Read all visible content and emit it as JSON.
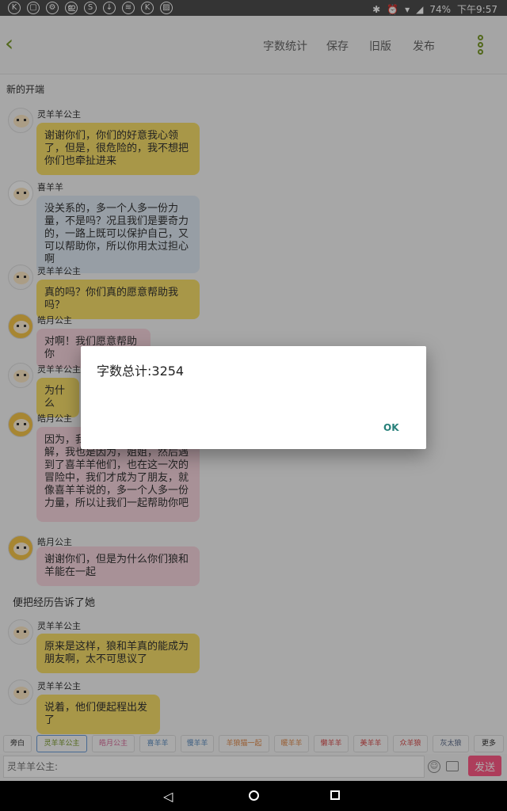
{
  "status_bar": {
    "battery": "74%",
    "time": "下午9:57",
    "left_icons": [
      "K",
      "▢",
      "⚙",
      "ഇ",
      "S",
      "↓",
      "≋",
      "K",
      "▨"
    ]
  },
  "header": {
    "back_icon": "chevron-left",
    "buttons": [
      "字数统计",
      "保存",
      "旧版",
      "发布"
    ],
    "more_icon": "vertical-dots"
  },
  "document": {
    "title": "新的开端"
  },
  "messages": [
    {
      "speaker": "灵羊羊公主",
      "text": "谢谢你们，你们的好意我心领了，但是，很危险的，我不想把你们也牵扯进来",
      "color": "#f8df6a",
      "avatar": "ling"
    },
    {
      "speaker": "喜羊羊",
      "text": "没关系的，多一个人多一份力量，不是吗？况且我们是要奇力的，一路上既可以保护自己，又可以帮助你，所以你用太过担心啊",
      "color": "#dfe9f3",
      "avatar": "xi"
    },
    {
      "speaker": "灵羊羊公主",
      "text": "真的吗？你们真的愿意帮助我吗？",
      "color": "#f8df6a",
      "avatar": "ling"
    },
    {
      "speaker": "皓月公主",
      "text": "对啊！我们愿意帮助你",
      "color": "#f8d6df",
      "avatar": "hao"
    },
    {
      "speaker": "灵羊羊公主",
      "text": "为什么",
      "color": "#f8df6a",
      "avatar": "ling"
    },
    {
      "speaker": "皓月公主",
      "text": "因为，我……在的感受我能理解，我也是因为，姐姐，然后遇到了喜羊羊他们，也在这一次的冒险中，我们才成为了朋友，就像喜羊羊说的，多一个人多一份力量，所以让我们一起帮助你吧",
      "color": "#f8d6df",
      "avatar": "hao"
    },
    {
      "speaker": "皓月公主",
      "text": "谢谢你们，但是为什么你们狼和羊能在一起",
      "color": "#f8d6df",
      "avatar": "hao"
    },
    {
      "narration": "便把经历告诉了她"
    },
    {
      "speaker": "灵羊羊公主",
      "text": "原来是这样，狼和羊真的能成为朋友啊，太不可思议了",
      "color": "#f8df6a",
      "avatar": "ling"
    },
    {
      "speaker": "灵羊羊公主",
      "text": "说着，他们便起程出发了",
      "color": "#f8df6a",
      "avatar": "ling"
    }
  ],
  "character_tabs": [
    {
      "label": "旁白",
      "color": "#333333"
    },
    {
      "label": "灵羊羊公主",
      "color": "#7a9a2a"
    },
    {
      "label": "皓月公主",
      "color": "#d86b9a"
    },
    {
      "label": "喜羊羊",
      "color": "#5a8bc0"
    },
    {
      "label": "慢羊羊",
      "color": "#5a8bc0"
    },
    {
      "label": "羊狼猫一起",
      "color": "#e08a4a"
    },
    {
      "label": "暖羊羊",
      "color": "#e08a4a"
    },
    {
      "label": "懒羊羊",
      "color": "#d84a4a"
    },
    {
      "label": "美羊羊",
      "color": "#d84a4a"
    },
    {
      "label": "众羊狼",
      "color": "#d84a4a"
    },
    {
      "label": "灰太狼",
      "color": "#5a6a8a"
    },
    {
      "label": "更多",
      "color": "#333333"
    }
  ],
  "input": {
    "placeholder": "灵羊羊公主:",
    "send_label": "发送"
  },
  "dialog": {
    "message": "字数总计:3254",
    "ok_label": "OK"
  }
}
